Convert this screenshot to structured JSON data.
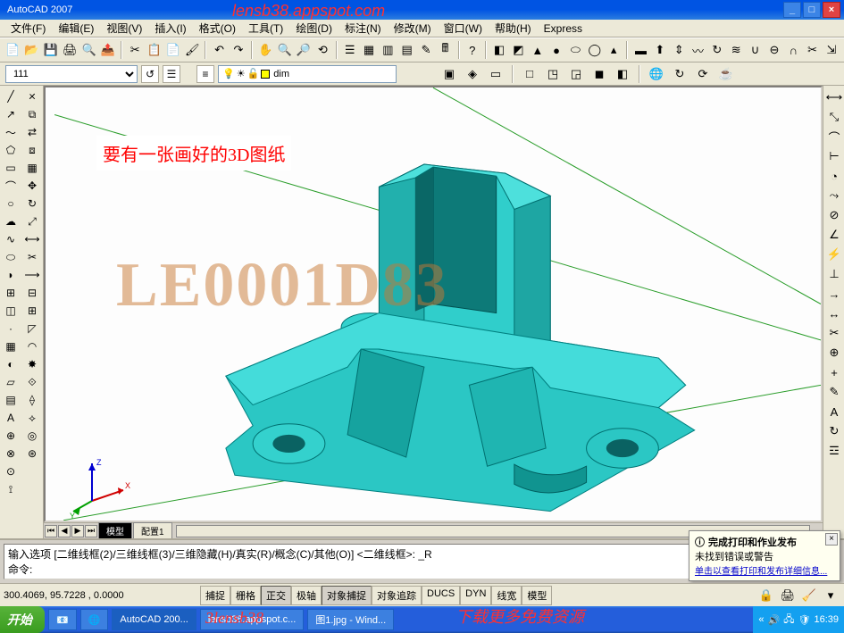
{
  "window": {
    "title": "AutoCAD 2007"
  },
  "menu": {
    "items": [
      "文件(F)",
      "编辑(E)",
      "视图(V)",
      "插入(I)",
      "格式(O)",
      "工具(T)",
      "绘图(D)",
      "标注(N)",
      "修改(M)",
      "窗口(W)",
      "帮助(H)",
      "Express"
    ]
  },
  "toolbar1_icons": [
    "new",
    "open",
    "save",
    "plot",
    "plot-preview",
    "publish",
    "|",
    "cut",
    "copy",
    "paste",
    "match",
    "|",
    "undo",
    "redo",
    "|",
    "pan",
    "zoom-realtime",
    "zoom-window",
    "zoom-prev",
    "|",
    "properties",
    "design-center",
    "tool-palettes",
    "sheet-set",
    "markup",
    "calc",
    "|",
    "help",
    "|",
    "solid-box",
    "solid-sphere",
    "solid-wedge",
    "solid-cylinder",
    "solid-cone",
    "solid-torus",
    "solid-pyramid",
    "|",
    "polysolid",
    "extrude",
    "presspull",
    "sweep",
    "revolve",
    "loft",
    "union",
    "subtract",
    "intersect"
  ],
  "propbar": {
    "layer_list": "111",
    "layer_current": "dim",
    "layer_color_name": "dim"
  },
  "annotation": {
    "text": "要有一张画好的3D图纸"
  },
  "watermark": {
    "text": "LE0001D83"
  },
  "tabs": {
    "model": "模型",
    "layout1": "配置1"
  },
  "commandline": {
    "line1": "输入选项 [二维线框(2)/三维线框(3)/三维隐藏(H)/真实(R)/概念(C)/其他(O)] <二维线框>: _R",
    "line2": "命令:"
  },
  "popup": {
    "title": "完成打印和作业发布",
    "body": "未找到错误或警告",
    "link": "单击以查看打印和发布详细信息..."
  },
  "status": {
    "coords": "300.4069, 95.7228 , 0.0000",
    "toggles": [
      "捕捉",
      "栅格",
      "正交",
      "极轴",
      "对象捕捉",
      "对象追踪",
      "DUCS",
      "DYN",
      "线宽",
      "模型"
    ]
  },
  "taskbar": {
    "start": "开始",
    "items": [
      "AutoCAD 200...",
      "lensb38.appspot.c...",
      "图1.jpg - Wind..."
    ],
    "overlay1": "3lensb38",
    "overlay2": "下载更多免费资源",
    "time": "16:39"
  },
  "broken_banner": "lensb38.appspot.com"
}
